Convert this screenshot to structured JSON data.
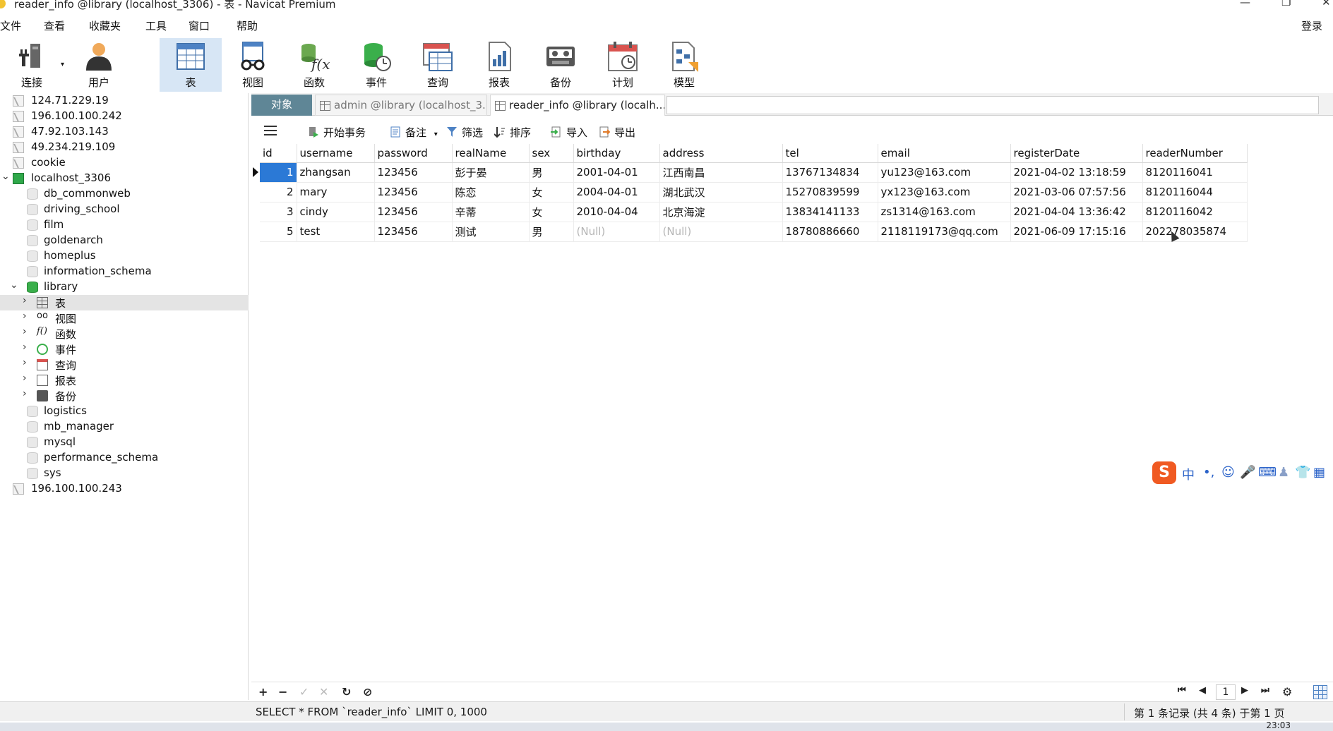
{
  "window": {
    "title": "reader_info @library (localhost_3306) - 表 - Navicat Premium",
    "minimize_glyph": "—",
    "maximize_glyph": "❐",
    "close_glyph": "✕"
  },
  "menu": {
    "items": [
      "文件",
      "查看",
      "收藏夹",
      "工具",
      "窗口",
      "帮助"
    ],
    "login": "登录"
  },
  "toolbar": {
    "items": [
      {
        "label": "连接",
        "icon": "plug-icon"
      },
      {
        "label": "用户",
        "icon": "user-icon"
      },
      {
        "label": "表",
        "icon": "table-icon",
        "active": true
      },
      {
        "label": "视图",
        "icon": "view-glasses-icon"
      },
      {
        "label": "函数",
        "icon": "function-icon"
      },
      {
        "label": "事件",
        "icon": "event-clock-icon"
      },
      {
        "label": "查询",
        "icon": "query-icon"
      },
      {
        "label": "报表",
        "icon": "report-icon"
      },
      {
        "label": "备份",
        "icon": "backup-tape-icon"
      },
      {
        "label": "计划",
        "icon": "schedule-calendar-icon"
      },
      {
        "label": "模型",
        "icon": "model-icon"
      }
    ]
  },
  "tree": {
    "connections_top": [
      "124.71.229.19",
      "196.100.100.242",
      "47.92.103.143",
      "49.234.219.109",
      "cookie"
    ],
    "localhost": "localhost_3306",
    "databases_before": [
      "db_commonweb",
      "driving_school",
      "film",
      "goldenarch",
      "homeplus",
      "information_schema"
    ],
    "library": "library",
    "library_children": [
      "表",
      "视图",
      "函数",
      "事件",
      "查询",
      "报表",
      "备份"
    ],
    "databases_after": [
      "logistics",
      "mb_manager",
      "mysql",
      "performance_schema",
      "sys"
    ],
    "connection_bottom": "196.100.100.243"
  },
  "tabs": {
    "objects": "对象",
    "tab1": "admin @library (localhost_3...",
    "tab2": "reader_info @library (localh..."
  },
  "grid_toolbar": {
    "begin_tx": "开始事务",
    "note": "备注",
    "filter": "筛选",
    "sort": "排序",
    "import": "导入",
    "export": "导出"
  },
  "table": {
    "columns": [
      "id",
      "username",
      "password",
      "realName",
      "sex",
      "birthday",
      "address",
      "tel",
      "email",
      "registerDate",
      "readerNumber"
    ],
    "rows": [
      [
        "1",
        "zhangsan",
        "123456",
        "彭于晏",
        "男",
        "2001-04-01",
        "江西南昌",
        "13767134834",
        "yu123@163.com",
        "2021-04-02 13:18:59",
        "8120116041"
      ],
      [
        "2",
        "mary",
        "123456",
        "陈恋",
        "女",
        "2004-04-01",
        "湖北武汉",
        "15270839599",
        "yx123@163.com",
        "2021-03-06 07:57:56",
        "8120116044"
      ],
      [
        "3",
        "cindy",
        "123456",
        "辛蒂",
        "女",
        "2010-04-04",
        "北京海淀",
        "13834141133",
        "zs1314@163.com",
        "2021-04-04 13:36:42",
        "8120116042"
      ],
      [
        "5",
        "test",
        "123456",
        "测试",
        "男",
        "(Null)",
        "(Null)",
        "18780886660",
        "2118119173@qq.com",
        "2021-06-09 17:15:16",
        "202278035874"
      ]
    ]
  },
  "bottom_bar": {
    "add": "+",
    "remove": "−",
    "apply": "✓",
    "discard": "✕",
    "refresh": "↻",
    "stop": "⊘",
    "first": "⏮",
    "prev": "◀",
    "page": "1",
    "next": "▶",
    "last": "⏭",
    "settings": "⚙"
  },
  "status": {
    "sql": "SELECT * FROM `reader_info` LIMIT 0, 1000",
    "page_info": "第 1 条记录 (共 4 条) 于第 1 页"
  },
  "taskbar": {
    "clock": "23:03"
  },
  "ime": {
    "logo": "S",
    "mode": "中"
  },
  "colors": {
    "accent": "#2b79d6",
    "objects_tab": "#5f8696",
    "active_tool": "#d7e6f5"
  }
}
